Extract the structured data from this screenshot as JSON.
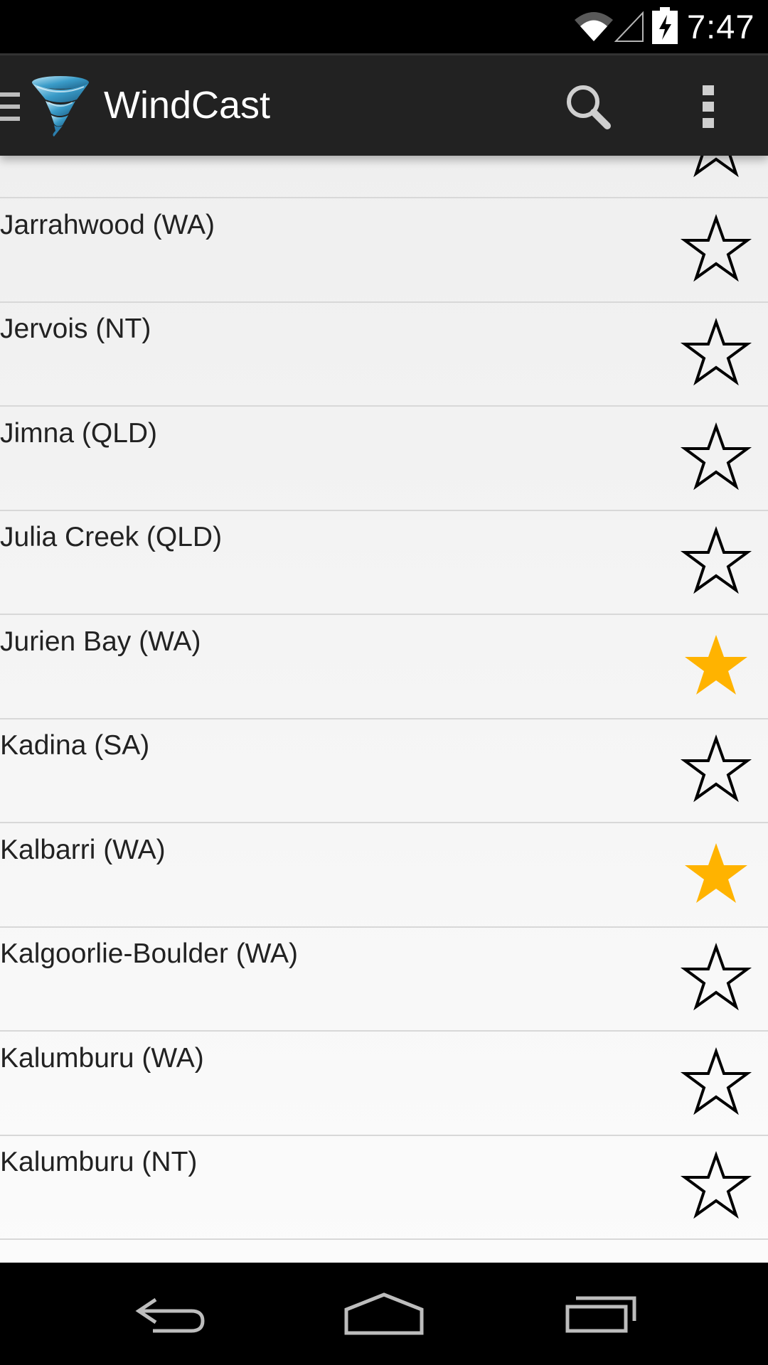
{
  "status_bar": {
    "time": "7:47",
    "icons": [
      "wifi-icon",
      "cell-signal-icon",
      "battery-charging-icon"
    ]
  },
  "action_bar": {
    "title": "WindCast",
    "app_icon": "tornado-icon",
    "actions": [
      "search-icon",
      "overflow-menu-icon"
    ]
  },
  "list": {
    "star_color_on": "#FFB300",
    "star_color_off": "#000000",
    "items": [
      {
        "label": "",
        "favorite": false
      },
      {
        "label": "Jarrahwood (WA)",
        "favorite": false
      },
      {
        "label": "Jervois (NT)",
        "favorite": false
      },
      {
        "label": "Jimna (QLD)",
        "favorite": false
      },
      {
        "label": "Julia Creek (QLD)",
        "favorite": false
      },
      {
        "label": "Jurien Bay (WA)",
        "favorite": true
      },
      {
        "label": "Kadina (SA)",
        "favorite": false
      },
      {
        "label": "Kalbarri (WA)",
        "favorite": true
      },
      {
        "label": "Kalgoorlie-Boulder (WA)",
        "favorite": false
      },
      {
        "label": "Kalumburu (WA)",
        "favorite": false
      },
      {
        "label": "Kalumburu (NT)",
        "favorite": false
      }
    ]
  },
  "nav_bar": {
    "buttons": [
      "back-icon",
      "home-icon",
      "recent-apps-icon"
    ]
  }
}
